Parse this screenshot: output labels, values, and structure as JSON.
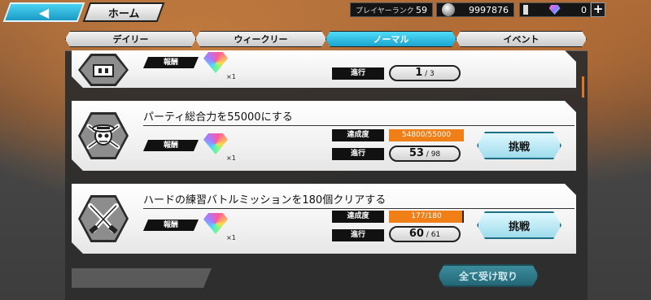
{
  "header": {
    "home_label": "ホーム",
    "rank_label": "プレイヤーランク",
    "rank_value": "59",
    "coins": "9997876",
    "gems": "0",
    "plus": "+"
  },
  "tabs": [
    {
      "label": "デイリー"
    },
    {
      "label": "ウィークリー"
    },
    {
      "label": "ノーマル",
      "active": true
    },
    {
      "label": "イベント"
    }
  ],
  "missions": [
    {
      "title": "",
      "reward_label": "報酬",
      "reward_count": "×1",
      "progress_label": "進行",
      "progress": "1",
      "target": "3"
    },
    {
      "title": "パーティ総合力を55000にする",
      "reward_label": "報酬",
      "reward_count": "×1",
      "achievement_label": "達成度",
      "achievement_text": "54800/55000",
      "achievement_fraction": 0.9964,
      "progress_label": "進行",
      "progress": "53",
      "target": "98",
      "button_label": "挑戦",
      "icon": "straw-hat-jolly-roger-icon"
    },
    {
      "title": "ハードの練習バトルミッションを180個クリアする",
      "reward_label": "報酬",
      "reward_count": "×1",
      "achievement_label": "達成度",
      "achievement_text": "177/180",
      "achievement_fraction": 0.9833,
      "progress_label": "進行",
      "progress": "60",
      "target": "61",
      "button_label": "挑戦",
      "icon": "crossed-swords-icon"
    }
  ],
  "claim_all_label": "全て受け取り",
  "colors": {
    "accent": "#1ca4cf",
    "progress_fill": "#f07f18"
  }
}
